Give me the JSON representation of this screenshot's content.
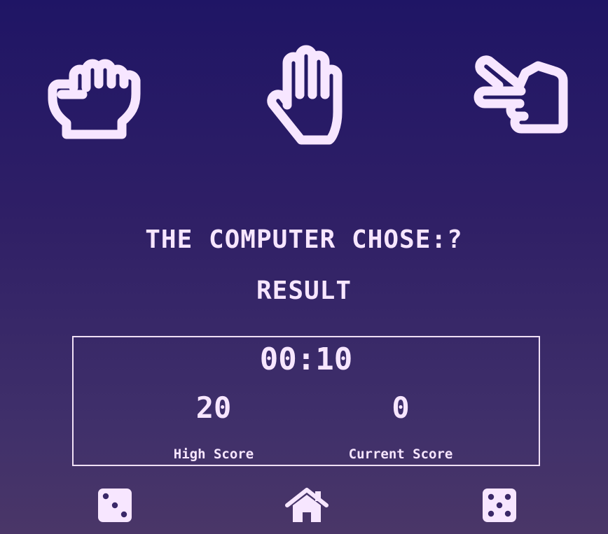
{
  "choices": [
    {
      "name": "rock",
      "icon": "fist-icon"
    },
    {
      "name": "paper",
      "icon": "open-hand-icon"
    },
    {
      "name": "scissors",
      "icon": "scissors-hand-icon"
    }
  ],
  "computer_choice_text": "THE COMPUTER CHOSE:?",
  "result_text": "RESULT",
  "timer": "00:10",
  "scores": {
    "high_value": "20",
    "high_label": "High Score",
    "current_value": "0",
    "current_label": "Current Score"
  },
  "nav": [
    {
      "icon": "dice-three-icon"
    },
    {
      "icon": "home-icon"
    },
    {
      "icon": "dice-five-icon"
    }
  ],
  "colors": {
    "foreground": "#f7e6ff",
    "background_top": "#1f1565",
    "background_bottom": "#4a3668"
  }
}
